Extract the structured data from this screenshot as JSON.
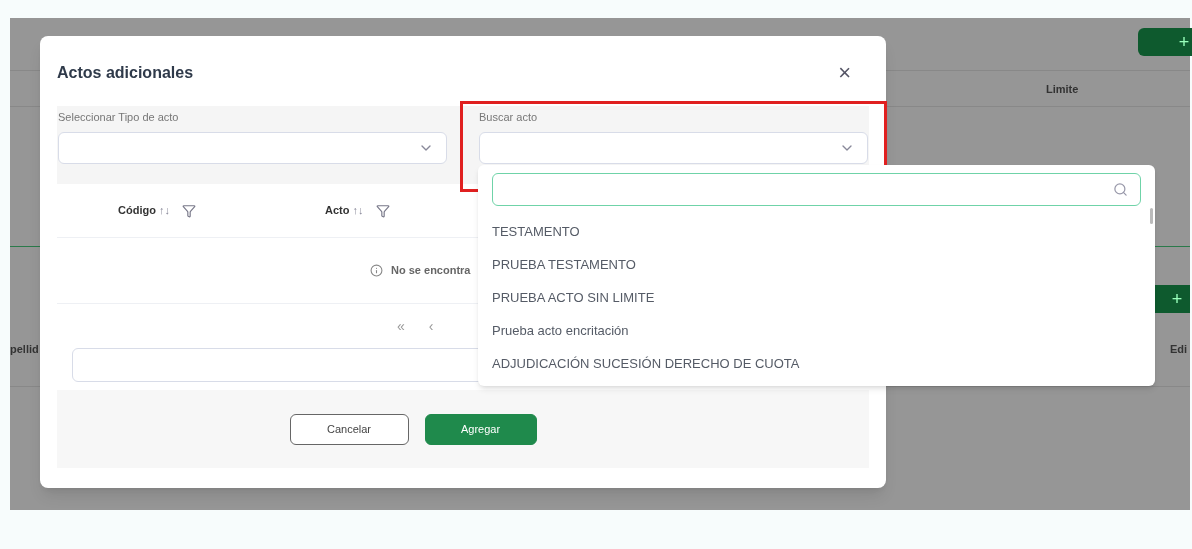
{
  "background_page": {
    "add_buttons": [
      "+",
      "+"
    ],
    "column_headers": [
      "Limite",
      "pellid",
      "Edi"
    ]
  },
  "modal": {
    "title": "Actos adicionales",
    "close": "×",
    "filters": [
      {
        "label": "Seleccionar Tipo de acto",
        "highlighted": false
      },
      {
        "label": "Buscar acto",
        "highlighted": true
      }
    ],
    "table": {
      "columns": [
        {
          "label": "Código",
          "sort": "↑↓"
        },
        {
          "label": "Acto",
          "sort": "↑↓"
        }
      ],
      "empty_message": "No se encontra"
    },
    "pagination": [
      "«",
      "‹"
    ],
    "buttons": [
      {
        "label": "Cancelar",
        "kind": "secondary"
      },
      {
        "label": "Agregar",
        "kind": "primary"
      }
    ]
  },
  "dropdown": {
    "options": [
      "TESTAMENTO",
      "PRUEBA TESTAMENTO",
      "PRUEBA ACTO SIN LIMITE",
      "Prueba acto encritación",
      "ADJUDICACIÓN SUCESIÓN DERECHO DE CUOTA"
    ]
  }
}
